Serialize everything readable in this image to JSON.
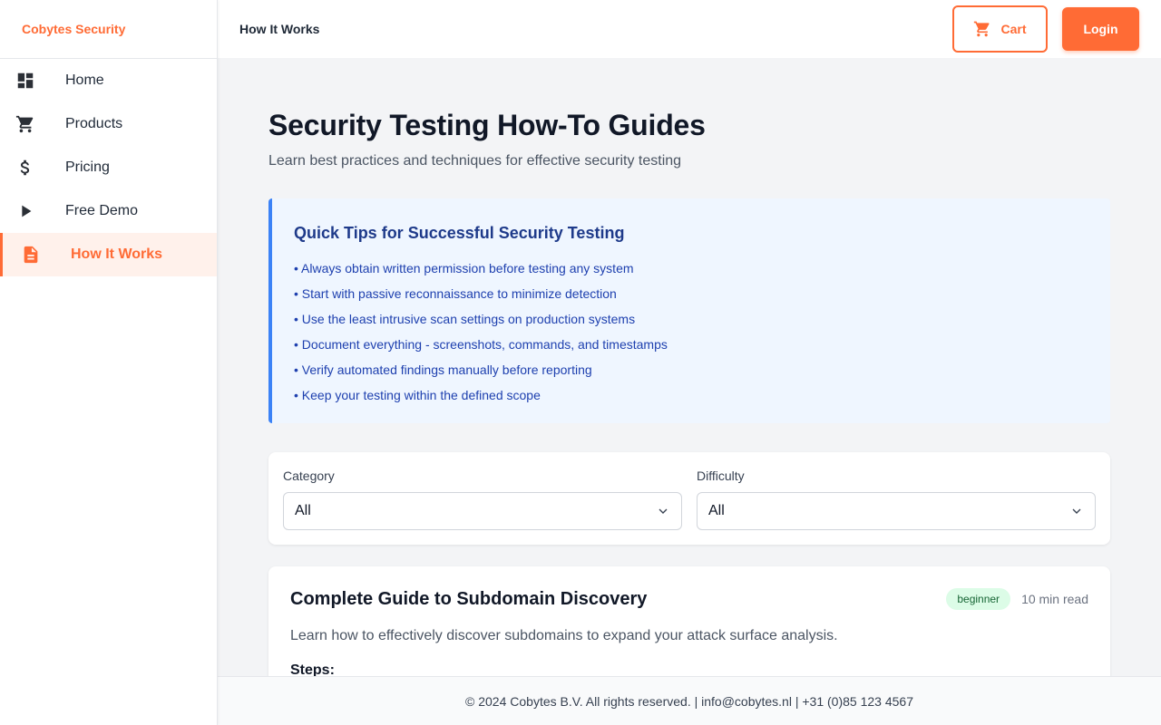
{
  "brand": {
    "name": "Cobytes Security",
    "color": "#ff6b35"
  },
  "sidebar": {
    "items": [
      {
        "label": "Home",
        "icon": "dashboard-icon"
      },
      {
        "label": "Products",
        "icon": "cart-icon"
      },
      {
        "label": "Pricing",
        "icon": "dollar-icon"
      },
      {
        "label": "Free Demo",
        "icon": "play-icon"
      },
      {
        "label": "How It Works",
        "icon": "document-icon",
        "active": true
      }
    ]
  },
  "header": {
    "title": "How It Works",
    "cart_label": "Cart",
    "cart_icon": "cart-icon",
    "login_label": "Login"
  },
  "main": {
    "title": "Security Testing How-To Guides",
    "subtitle": "Learn best practices and techniques for effective security testing",
    "tips": {
      "title": "Quick Tips for Successful Security Testing",
      "items": [
        "• Always obtain written permission before testing any system",
        "• Start with passive reconnaissance to minimize detection",
        "• Use the least intrusive scan settings on production systems",
        "• Document everything - screenshots, commands, and timestamps",
        "• Verify automated findings manually before reporting",
        "• Keep your testing within the defined scope"
      ]
    },
    "filters": {
      "category": {
        "label": "Category",
        "value": "All"
      },
      "difficulty": {
        "label": "Difficulty",
        "value": "All"
      }
    },
    "guides": [
      {
        "title": "Complete Guide to Subdomain Discovery",
        "difficulty": "beginner",
        "read_time": "10 min read",
        "description": "Learn how to effectively discover subdomains to expand your attack surface analysis.",
        "steps_label": "Steps:"
      }
    ]
  },
  "footer": {
    "text": "© 2024 Cobytes B.V. All rights reserved. | info@cobytes.nl | +31 (0)85 123 4567"
  },
  "colors": {
    "accent": "#ff6b35",
    "tip_border": "#3b82f6",
    "tip_bg": "#eff6ff",
    "badge_bg": "#dcfce7"
  }
}
